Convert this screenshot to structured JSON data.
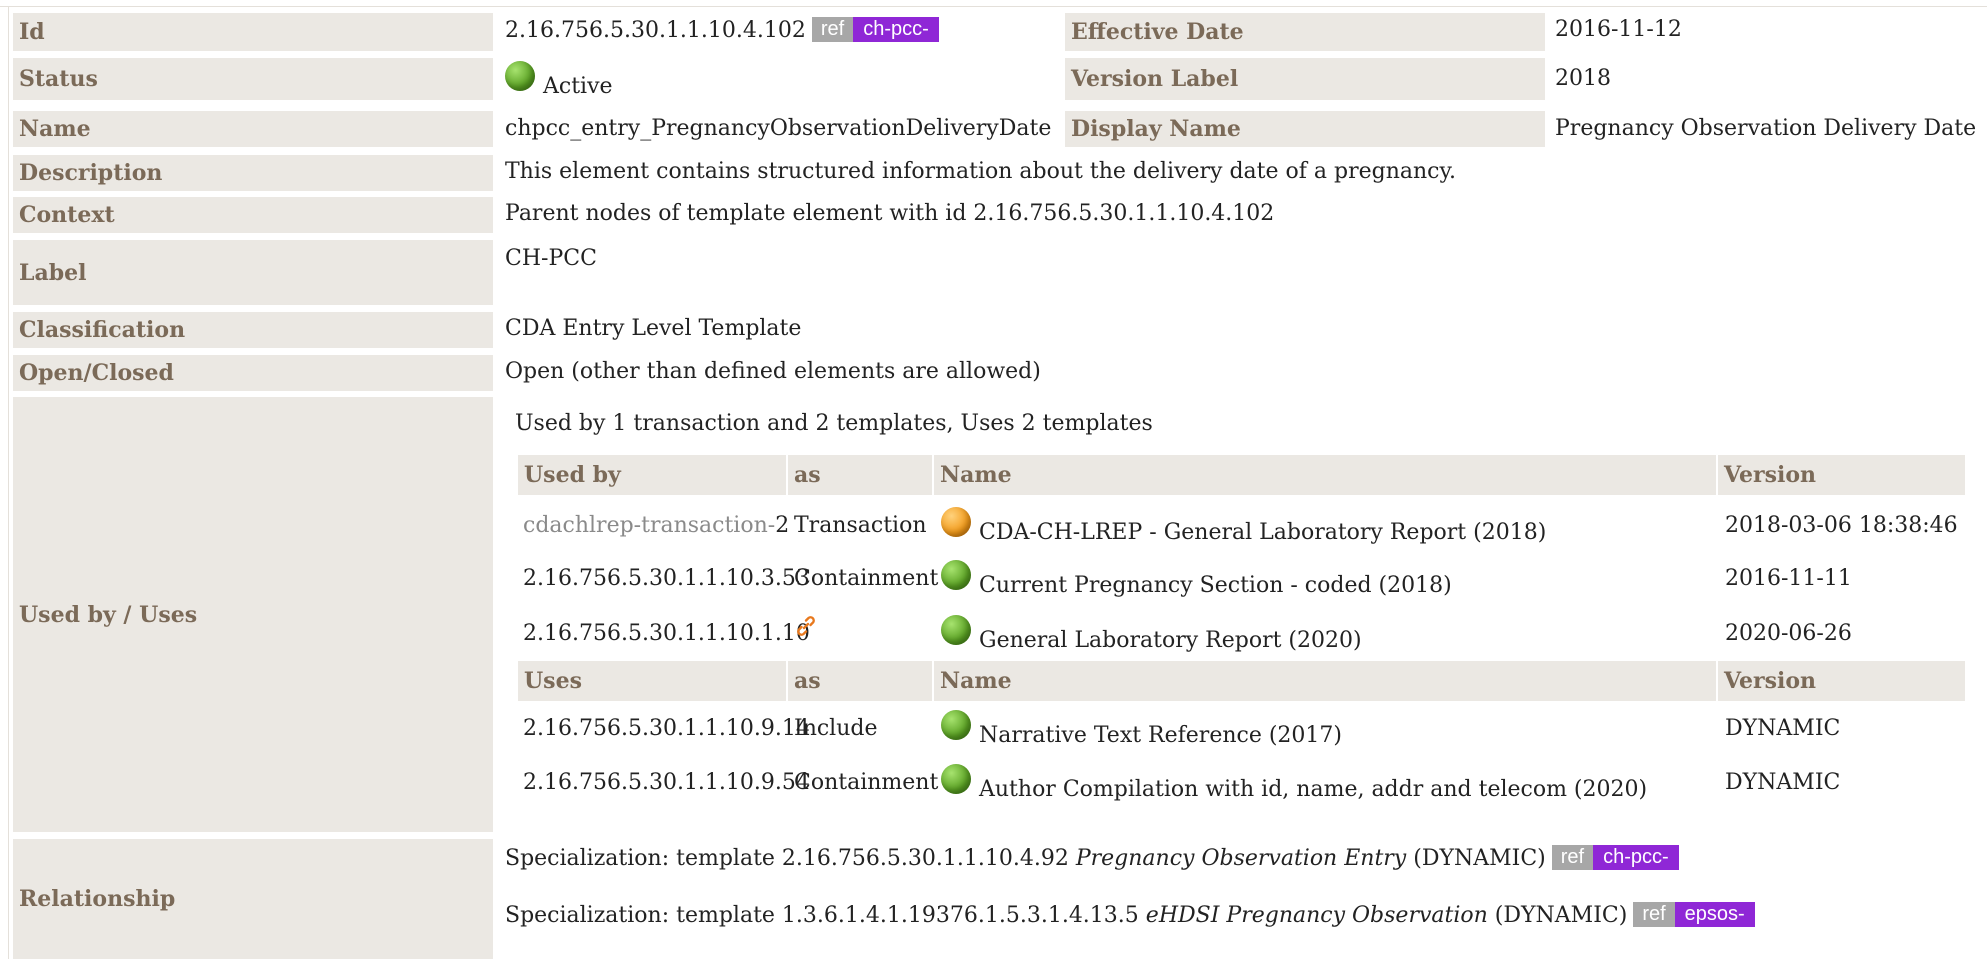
{
  "rows": {
    "id": {
      "label": "Id",
      "value": "2.16.756.5.30.1.1.10.4.102",
      "ref": "ref",
      "prefix": "ch-pcc-"
    },
    "effective_date": {
      "label": "Effective Date",
      "value": "2016-11-12"
    },
    "status": {
      "label": "Status",
      "value": "Active",
      "icon": "status-active-icon",
      "color": "#5aa123"
    },
    "version_label": {
      "label": "Version Label",
      "value": "2018"
    },
    "name": {
      "label": "Name",
      "value": "chpcc_entry_PregnancyObservationDeliveryDate"
    },
    "display_name": {
      "label": "Display Name",
      "value": "Pregnancy Observation Delivery Date"
    },
    "description": {
      "label": "Description",
      "value": "This element contains structured information about the delivery date of a pregnancy."
    },
    "context": {
      "label": "Context",
      "value": "Parent nodes of template element with id 2.16.756.5.30.1.1.10.4.102"
    },
    "label": {
      "label": "Label",
      "value": "CH-PCC"
    },
    "classification": {
      "label": "Classification",
      "value": "CDA Entry Level Template"
    },
    "open_closed": {
      "label": "Open/Closed",
      "value": "Open (other than defined elements are allowed)"
    },
    "used_by_uses": {
      "label": "Used by / Uses",
      "summary": "Used by 1 transaction and 2 templates, Uses 2 templates"
    },
    "relationship": {
      "label": "Relationship"
    }
  },
  "used_by_table": {
    "headers": [
      "Used by",
      "as",
      "Name",
      "Version"
    ],
    "rows": [
      {
        "id_prefix": "cdachlrep-transaction-",
        "id_suffix": "2",
        "as": "Transaction",
        "status": "draft",
        "name": "CDA-CH-LREP - General Laboratory Report (2018)",
        "version": "2018-03-06 18:38:46"
      },
      {
        "id": "2.16.756.5.30.1.1.10.3.53",
        "as": "Containment",
        "status": "active",
        "name": "Current Pregnancy Section - coded (2018)",
        "version": "2016-11-11"
      },
      {
        "id": "2.16.756.5.30.1.1.10.1.10",
        "as_icon": "link-icon",
        "status": "active",
        "name": "General Laboratory Report (2020)",
        "version": "2020-06-26"
      }
    ]
  },
  "uses_table": {
    "headers": [
      "Uses",
      "as",
      "Name",
      "Version"
    ],
    "rows": [
      {
        "id": "2.16.756.5.30.1.1.10.9.14",
        "as": "Include",
        "status": "active",
        "name": "Narrative Text Reference (2017)",
        "version": "DYNAMIC"
      },
      {
        "id": "2.16.756.5.30.1.1.10.9.54",
        "as": "Containment",
        "status": "active",
        "name": "Author Compilation with id, name, addr and telecom (2020)",
        "version": "DYNAMIC"
      }
    ]
  },
  "relationships": [
    {
      "prefix_text": "Specialization: template 2.16.756.5.30.1.1.10.4.92",
      "name": "Pregnancy Observation Entry",
      "suffix_text": "(DYNAMIC)",
      "ref": "ref",
      "project": "ch-pcc-"
    },
    {
      "prefix_text": "Specialization: template 1.3.6.1.4.1.19376.1.5.3.1.4.13.5",
      "name": "eHDSI Pregnancy Observation",
      "suffix_text": "(DYNAMIC)",
      "ref": "ref",
      "project": "epsos-"
    }
  ]
}
